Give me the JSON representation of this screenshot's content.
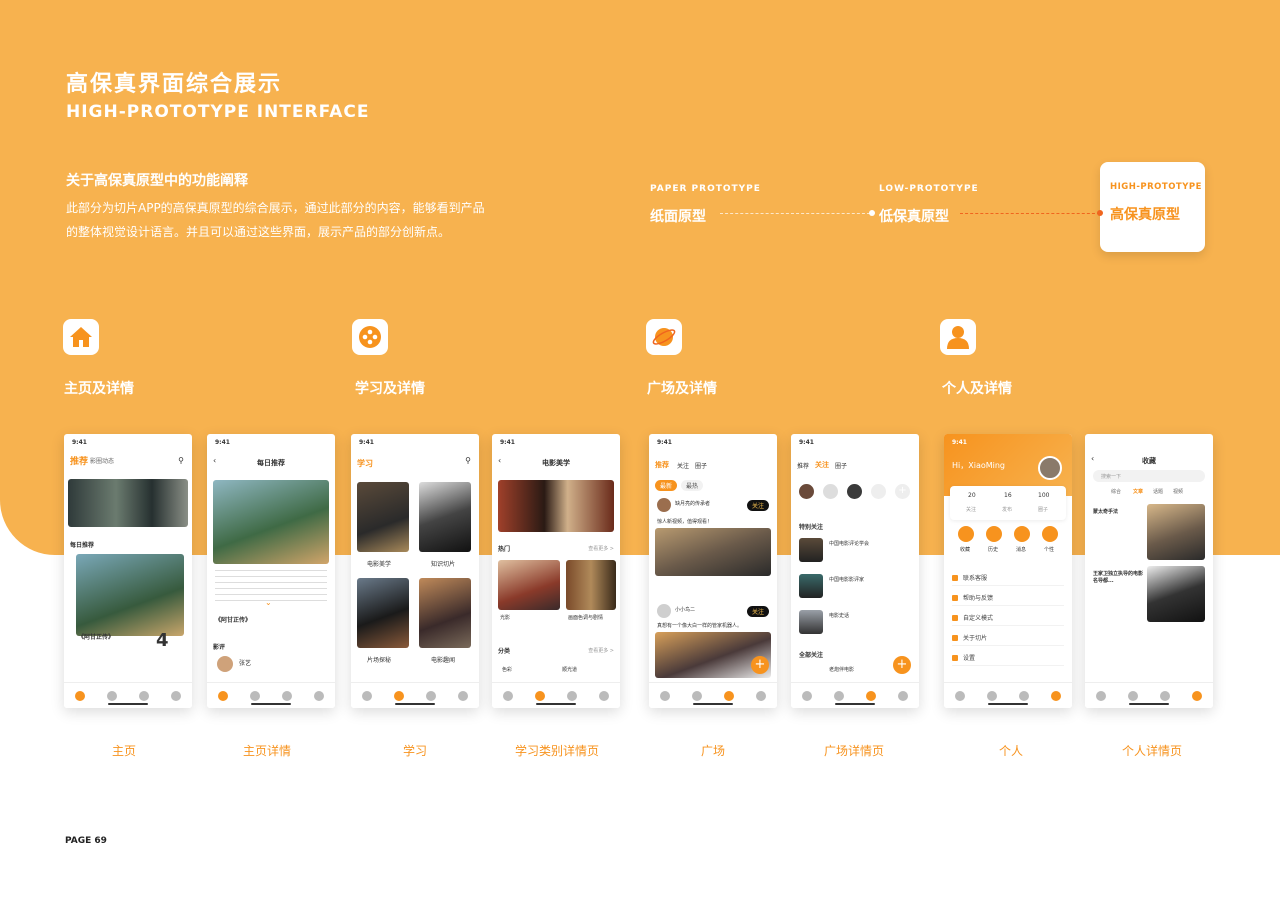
{
  "header": {
    "title_cn": "高保真界面综合展示",
    "title_en": "HIGH-PROTOTYPE INTERFACE",
    "desc_title": "关于高保真原型中的功能阐释",
    "desc_line1": "此部分为切片APP的高保真原型的综合展示，通过此部分的内容，能够看到产品",
    "desc_line2": "的整体视觉设计语言。并且可以通过这些界面，展示产品的部分创新点。"
  },
  "prototypes": [
    {
      "en": "PAPER PROTOTYPE",
      "cn": "纸面原型"
    },
    {
      "en": "LOW-PROTOTYPE",
      "cn": "低保真原型"
    },
    {
      "en": "HIGH-PROTOTYPE",
      "cn": "高保真原型"
    }
  ],
  "sections": [
    {
      "title": "主页及详情",
      "icon": "home-icon"
    },
    {
      "title": "学习及详情",
      "icon": "film-reel-icon"
    },
    {
      "title": "广场及详情",
      "icon": "planet-icon"
    },
    {
      "title": "个人及详情",
      "icon": "user-icon"
    }
  ],
  "captions": [
    "主页",
    "主页详情",
    "学习",
    "学习类别详情页",
    "广场",
    "广场详情页",
    "个人",
    "个人详情页"
  ],
  "phones": {
    "time": "9:41",
    "home": {
      "tab1": "推荐",
      "tab2": "影圈动态",
      "daily": "每日推荐",
      "movie": "《阿甘正传》",
      "date_num": "4"
    },
    "home_detail": {
      "title": "每日推荐",
      "movie": "《阿甘正传》",
      "review": "影评",
      "user": "张艺"
    },
    "learn": {
      "title": "学习",
      "cats": [
        "电影美学",
        "知识切片",
        "片场探秘",
        "电影趣闻"
      ]
    },
    "learn_detail": {
      "title": "电影美学",
      "hot": "热门",
      "more": "查看更多 >",
      "cat": "分类",
      "item1": "光影",
      "item2": "画面色调与剧情",
      "chip1": "色彩",
      "chip2": "顺光道"
    },
    "square": {
      "tab1": "推荐",
      "tab2": "关注",
      "tab3": "圈子",
      "chip1": "最新",
      "chip2": "最热",
      "user1": "缺月亮的传承者",
      "follow": "关注",
      "post1": "惊人新视频，值得观看！",
      "user2": "小小鸟二",
      "post2": "真想有一个像大白一样的管家机器人。"
    },
    "square_detail": {
      "tab1": "推荐",
      "tab2": "关注",
      "tab3": "圈子",
      "special": "特别关注",
      "g1": "中国电影评论学会",
      "g2": "中国电影影评家",
      "g3": "电影史话",
      "all": "全部关注",
      "g4": "老炮伴电影"
    },
    "profile": {
      "greeting": "Hi，XiaoMing",
      "stats": [
        {
          "n": "20",
          "l": "关注"
        },
        {
          "n": "16",
          "l": "发布"
        },
        {
          "n": "100",
          "l": "圈子"
        }
      ],
      "actions": [
        "收藏",
        "历史",
        "消息",
        "个性"
      ],
      "menu": [
        "联系客服",
        "帮助与反馈",
        "自定义模式",
        "关于切片",
        "设置"
      ]
    },
    "profile_detail": {
      "title": "收藏",
      "search": "搜索一下",
      "tabs": [
        "综合",
        "文章",
        "话题",
        "视频"
      ],
      "a1": "蒙太奇手法",
      "a2": "王家卫独立执导的电影名导都..."
    }
  },
  "footer": {
    "page": "PAGE 69"
  },
  "colors": {
    "accent": "#F7931E",
    "band": "#F7B24F"
  }
}
